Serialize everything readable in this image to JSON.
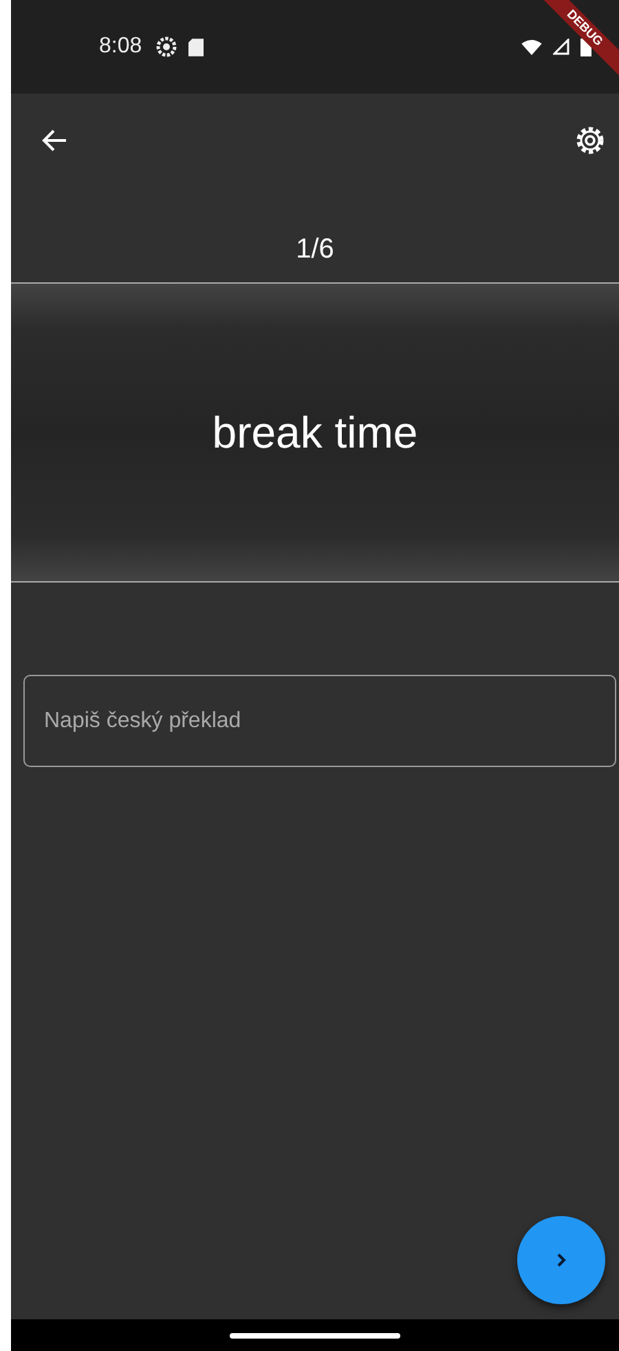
{
  "status_bar": {
    "time": "8:08"
  },
  "debug_banner": {
    "label": "DEBUG"
  },
  "counter": "1/6",
  "card": {
    "word": "break time"
  },
  "answer_field": {
    "placeholder": "Napiš český překlad"
  }
}
